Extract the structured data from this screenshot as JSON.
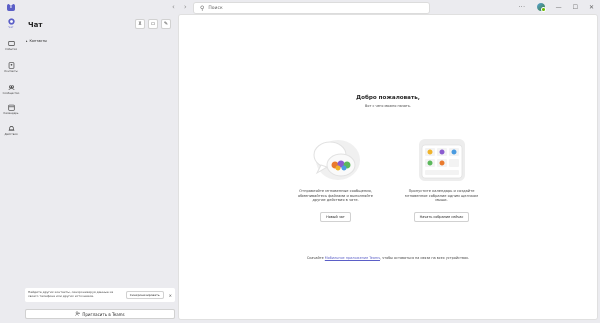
{
  "titlebar": {
    "search_placeholder": "Поиск",
    "more": "···"
  },
  "rail": {
    "items": [
      {
        "label": "Чат",
        "icon": "chat-icon"
      },
      {
        "label": "События",
        "icon": "activity-icon"
      },
      {
        "label": "Контакты",
        "icon": "contacts-icon"
      },
      {
        "label": "Сообщество",
        "icon": "community-icon"
      },
      {
        "label": "Календарь",
        "icon": "calendar-icon"
      },
      {
        "label": "Действия",
        "icon": "actions-icon"
      }
    ]
  },
  "chatpanel": {
    "title": "Чат",
    "contacts_label": "Контакты",
    "sync_text": "Найдите других контакты, синхронизируя данные из своего телефона или других источников.",
    "sync_button": "Синхронизировать",
    "invite_button": "Пригласить в Teams"
  },
  "main": {
    "welcome_title": "Добро пожаловать,",
    "welcome_sub": "Вот с чего можно начать.",
    "card1_text": "Отправляйте мгновенные сообщения, обменивайтесь файлами и выполняйте другие действия в чате.",
    "card1_button": "Новый чат",
    "card2_text": "Пропустите календарь и создайте мгновенное собрание одним щелчком мыши.",
    "card2_button": "Начать собрание сейчас",
    "footer_before": "Скачайте ",
    "footer_link": "Мобильное приложение Teams",
    "footer_after": ", чтобы оставаться на связи на всех устройствах."
  },
  "colors": {
    "accent": "#5b5fc7",
    "background": "#ebebef",
    "surface": "#ffffff"
  }
}
